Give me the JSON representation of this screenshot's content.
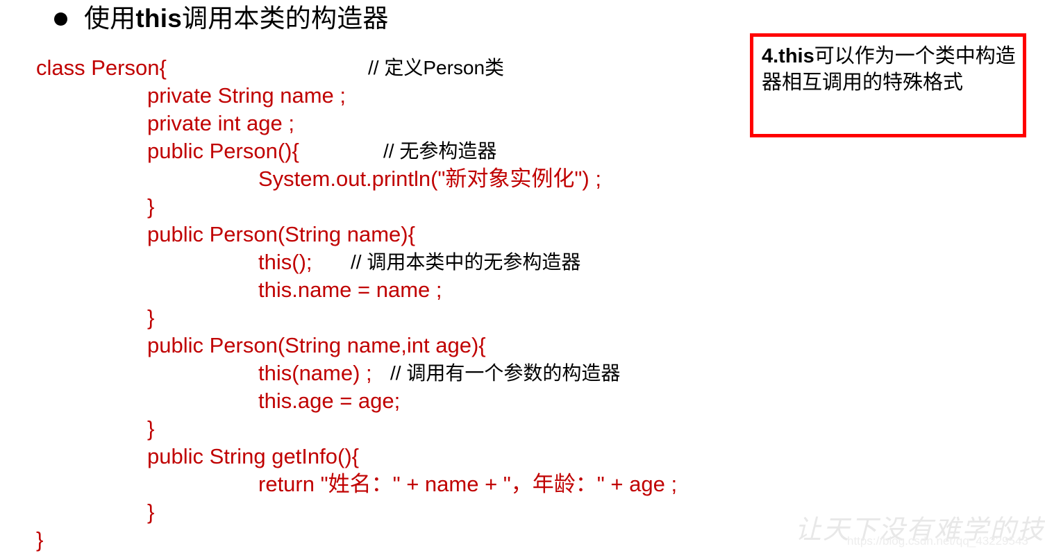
{
  "title": {
    "bullet": "●",
    "prefix": "使用",
    "keyword": "this",
    "suffix": "调用本类的构造器"
  },
  "callout": {
    "number_keyword": "4.this",
    "body": "可以作为一个类中构造器相互调用的特殊格式"
  },
  "code": {
    "lines": [
      {
        "indent": 0,
        "code": "class Person{",
        "comment": "// 定义Person类",
        "comment_pos": "cmt-at-530"
      },
      {
        "indent": 1,
        "code": "private String name ;",
        "comment": "",
        "comment_pos": ""
      },
      {
        "indent": 1,
        "code": "private int age ;",
        "comment": "",
        "comment_pos": ""
      },
      {
        "indent": 1,
        "code": "public Person(){",
        "comment": "// 无参构造器",
        "comment_pos": "cmt-at-552"
      },
      {
        "indent": 2,
        "code": "System.out.println(\"新对象实例化\") ;",
        "comment": "",
        "comment_pos": ""
      },
      {
        "indent": 1,
        "code": "}",
        "comment": "",
        "comment_pos": ""
      },
      {
        "indent": 1,
        "code": "public Person(String name){",
        "comment": "",
        "comment_pos": ""
      },
      {
        "indent": 2,
        "code": "this();",
        "comment": "// 调用本类中的无参构造器",
        "comment_pos": "cmt-at-505"
      },
      {
        "indent": 2,
        "code": "this.name = name ;",
        "comment": "",
        "comment_pos": ""
      },
      {
        "indent": 1,
        "code": "}",
        "comment": "",
        "comment_pos": ""
      },
      {
        "indent": 1,
        "code": "public Person(String name,int age){",
        "comment": "",
        "comment_pos": ""
      },
      {
        "indent": 2,
        "code": "this(name) ;",
        "comment": "// 调用有一个参数的构造器",
        "comment_pos": "cmt-at-562"
      },
      {
        "indent": 2,
        "code": "this.age = age;",
        "comment": "",
        "comment_pos": ""
      },
      {
        "indent": 1,
        "code": "}",
        "comment": "",
        "comment_pos": ""
      },
      {
        "indent": 1,
        "code": "public String getInfo(){",
        "comment": "",
        "comment_pos": ""
      },
      {
        "indent": 2,
        "code": "return \"姓名：\" + name + \"，年龄：\" + age ;",
        "comment": "",
        "comment_pos": ""
      },
      {
        "indent": 1,
        "code": "}",
        "comment": "",
        "comment_pos": ""
      },
      {
        "indent": 0,
        "code": "}",
        "comment": "",
        "comment_pos": ""
      }
    ]
  },
  "watermark": {
    "brand": "让天下没有难学的技术",
    "url": "https://blog.csdn.net/qq_43229543"
  },
  "colors": {
    "code_red": "#C00000",
    "box_border_red": "#FF0000",
    "comment_black": "#000000"
  }
}
